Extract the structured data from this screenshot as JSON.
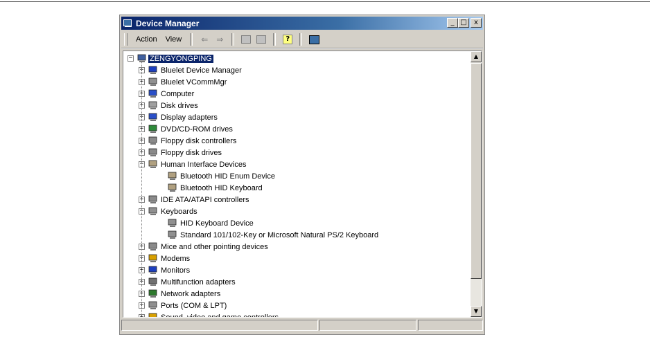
{
  "window": {
    "title": "Device Manager"
  },
  "caption_buttons": {
    "minimize": "_",
    "maximize": "□",
    "close": "x"
  },
  "menu": {
    "action": "Action",
    "view": "View"
  },
  "toolbar": {
    "back_glyph": "⇐",
    "forward_glyph": "⇒"
  },
  "tree": {
    "root": "ZENGYONGPING",
    "items": [
      {
        "label": "Bluelet Device Manager",
        "icon": "monitor-icon",
        "expander": "+"
      },
      {
        "label": "Bluelet VCommMgr",
        "icon": "connector-icon",
        "expander": "+"
      },
      {
        "label": "Computer",
        "icon": "computer-icon",
        "expander": "+"
      },
      {
        "label": "Disk drives",
        "icon": "disk-drive-icon",
        "expander": "+"
      },
      {
        "label": "Display adapters",
        "icon": "display-adapter-icon",
        "expander": "+"
      },
      {
        "label": "DVD/CD-ROM drives",
        "icon": "cdrom-icon",
        "expander": "+"
      },
      {
        "label": "Floppy disk controllers",
        "icon": "floppy-controller-icon",
        "expander": "+"
      },
      {
        "label": "Floppy disk drives",
        "icon": "floppy-drive-icon",
        "expander": "+"
      },
      {
        "label": "Human Interface Devices",
        "icon": "hid-icon",
        "expander": "−",
        "children": [
          "Bluetooth HID Enum Device",
          "Bluetooth HID Keyboard"
        ]
      },
      {
        "label": "IDE ATA/ATAPI controllers",
        "icon": "ide-icon",
        "expander": "+"
      },
      {
        "label": "Keyboards",
        "icon": "keyboard-icon",
        "expander": "−",
        "children": [
          "HID Keyboard Device",
          "Standard 101/102-Key or Microsoft Natural PS/2 Keyboard"
        ]
      },
      {
        "label": "Mice and other pointing devices",
        "icon": "mouse-icon",
        "expander": "+"
      },
      {
        "label": "Modems",
        "icon": "modem-icon",
        "expander": "+"
      },
      {
        "label": "Monitors",
        "icon": "monitor-icon",
        "expander": "+"
      },
      {
        "label": "Multifunction adapters",
        "icon": "multifunction-icon",
        "expander": "+"
      },
      {
        "label": "Network adapters",
        "icon": "network-adapter-icon",
        "expander": "+"
      },
      {
        "label": "Ports (COM & LPT)",
        "icon": "port-icon",
        "expander": "+"
      },
      {
        "label": "Sound, video and game controllers",
        "icon": "sound-icon",
        "expander": "+"
      }
    ]
  },
  "scrollbar": {
    "up": "▲",
    "down": "▼"
  }
}
